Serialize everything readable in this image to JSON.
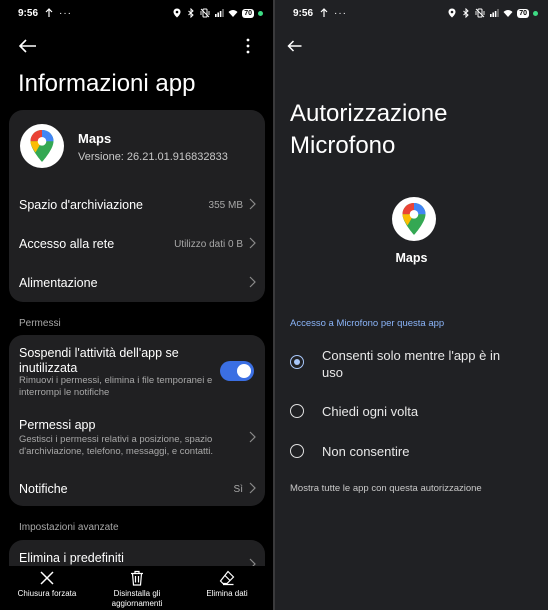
{
  "left": {
    "status": {
      "time": "9:56",
      "battery": "70"
    },
    "title": "Informazioni app",
    "app": {
      "name": "Maps",
      "version": "Versione: 26.21.01.916832833"
    },
    "rows": [
      {
        "label": "Spazio d'archiviazione",
        "value": "355 MB"
      },
      {
        "label": "Accesso alla rete",
        "value": "Utilizzo dati 0 B"
      },
      {
        "label": "Alimentazione",
        "value": ""
      }
    ],
    "permissions_section": "Permessi",
    "suspend": {
      "title": "Sospendi l'attività dell'app se inutilizzata",
      "subtitle": "Rimuovi i permessi, elimina i file temporanei e interrompi le notifiche",
      "enabled": true
    },
    "app_permissions": {
      "title": "Permessi app",
      "subtitle": "Gestisci i permessi relativi a posizione, spazio d'archiviazione, telefono, messaggi, e contatti."
    },
    "notifications": {
      "label": "Notifiche",
      "value": "Sì"
    },
    "advanced_section": "Impostazioni avanzate",
    "defaults": {
      "label": "Elimina i predefiniti"
    },
    "bottom_bar": {
      "force_stop": "Chiusura forzata",
      "uninstall_updates": "Disinstalla gli aggiornamenti",
      "clear_data": "Elimina dati"
    }
  },
  "right": {
    "status": {
      "time": "9:56",
      "battery": "70"
    },
    "title_line1": "Autorizzazione",
    "title_line2": "Microfono",
    "app_name": "Maps",
    "section": "Accesso a Microfono per questa app",
    "options": [
      {
        "label": "Consenti solo mentre l'app è in uso",
        "selected": true
      },
      {
        "label": "Chiedi ogni volta",
        "selected": false
      },
      {
        "label": "Non consentire",
        "selected": false
      }
    ],
    "show_all": "Mostra tutte le app con questa autorizzazione"
  },
  "icons": {
    "back": "back-arrow-icon",
    "menu": "more-vert-icon",
    "chevron": "chevron-right-icon",
    "force_stop": "close-icon",
    "uninstall": "trash-icon",
    "clear": "eraser-icon",
    "maps": "google-maps-pin-icon"
  },
  "colors": {
    "toggle_on": "#3b6fe3",
    "section_accent": "#8ab4f8",
    "radio_checked": "#a8c7fa"
  }
}
